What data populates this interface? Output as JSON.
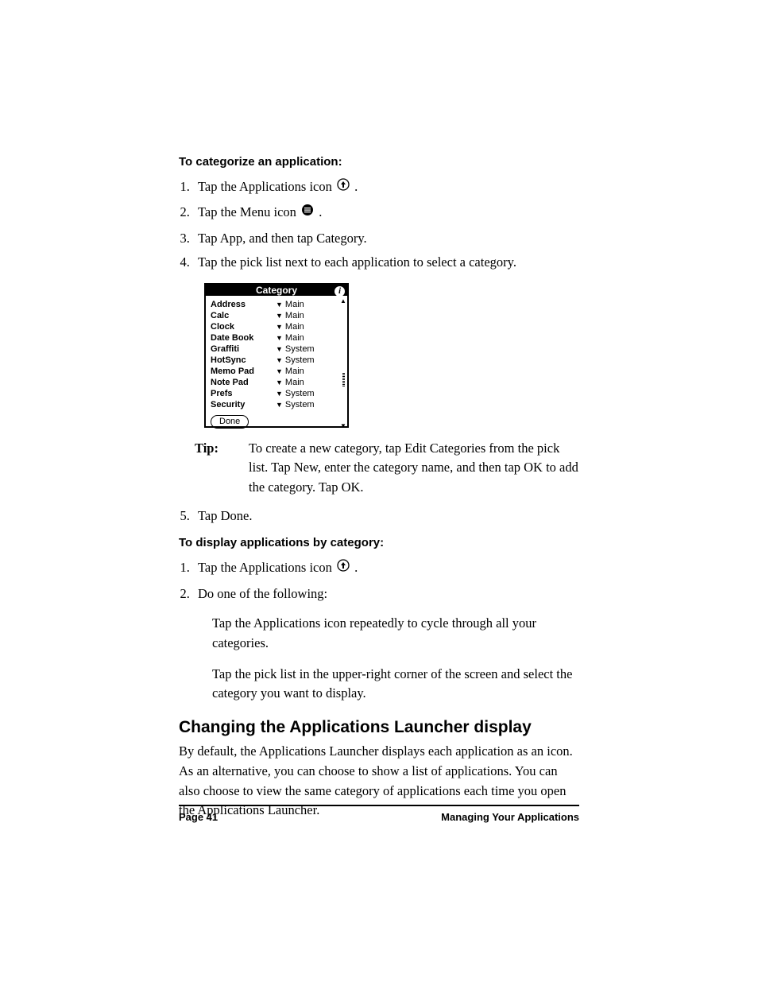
{
  "section1": {
    "heading": "To categorize an application:",
    "steps": {
      "s1a": "Tap the Applications icon ",
      "s1b": ".",
      "s2a": "Tap the Menu icon ",
      "s2b": ".",
      "s3": "Tap App, and then tap Category.",
      "s4": "Tap the pick list next to each application to select a category.",
      "s5": "Tap Done."
    }
  },
  "palm": {
    "title": "Category",
    "info": "i",
    "done": "Done",
    "rows": [
      {
        "app": "Address",
        "cat": "Main"
      },
      {
        "app": "Calc",
        "cat": "Main"
      },
      {
        "app": "Clock",
        "cat": "Main"
      },
      {
        "app": "Date Book",
        "cat": "Main"
      },
      {
        "app": "Graffiti",
        "cat": "System"
      },
      {
        "app": "HotSync",
        "cat": "System"
      },
      {
        "app": "Memo Pad",
        "cat": "Main"
      },
      {
        "app": "Note Pad",
        "cat": "Main"
      },
      {
        "app": "Prefs",
        "cat": "System"
      },
      {
        "app": "Security",
        "cat": "System"
      }
    ]
  },
  "tip": {
    "label": "Tip:",
    "body": "To create a new category, tap Edit Categories from the pick list. Tap New, enter the category name, and then tap OK to add the category. Tap OK."
  },
  "section2": {
    "heading": "To display applications by category:",
    "steps": {
      "s1a": "Tap the Applications icon ",
      "s1b": ".",
      "s2": "Do one of the following:"
    },
    "sub1": "Tap the Applications icon repeatedly to cycle through all your categories.",
    "sub2": "Tap the pick list in the upper-right corner of the screen and select the category you want to display."
  },
  "section3": {
    "heading": "Changing the Applications Launcher display",
    "body": "By default, the Applications Launcher displays each application as an icon. As an alternative, you can choose to show a list of applications. You can also choose to view the same category of applications each time you open the Applications Launcher."
  },
  "footer": {
    "left": "Page 41",
    "right": "Managing Your Applications"
  }
}
